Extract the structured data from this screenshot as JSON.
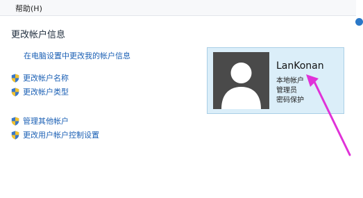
{
  "menu": {
    "help": "帮助(H)"
  },
  "page": {
    "title": "更改帐户信息"
  },
  "links": {
    "pc_settings": "在电脑设置中更改我的帐户信息"
  },
  "actions": [
    {
      "label": "更改帐户名称",
      "icon": "uac-shield-icon"
    },
    {
      "label": "更改帐户类型",
      "icon": "uac-shield-icon"
    },
    {
      "label": "管理其他帐户",
      "icon": "uac-shield-icon"
    },
    {
      "label": "更改用户帐户控制设置",
      "icon": "uac-shield-icon"
    }
  ],
  "account": {
    "name": "LanKonan",
    "type": "本地帐户",
    "role": "管理员",
    "password": "密码保护"
  },
  "colors": {
    "link": "#1a5fb4",
    "card_bg": "#dbeef9",
    "card_border": "#a9cfe6",
    "annotation_arrow": "#e032d8"
  }
}
